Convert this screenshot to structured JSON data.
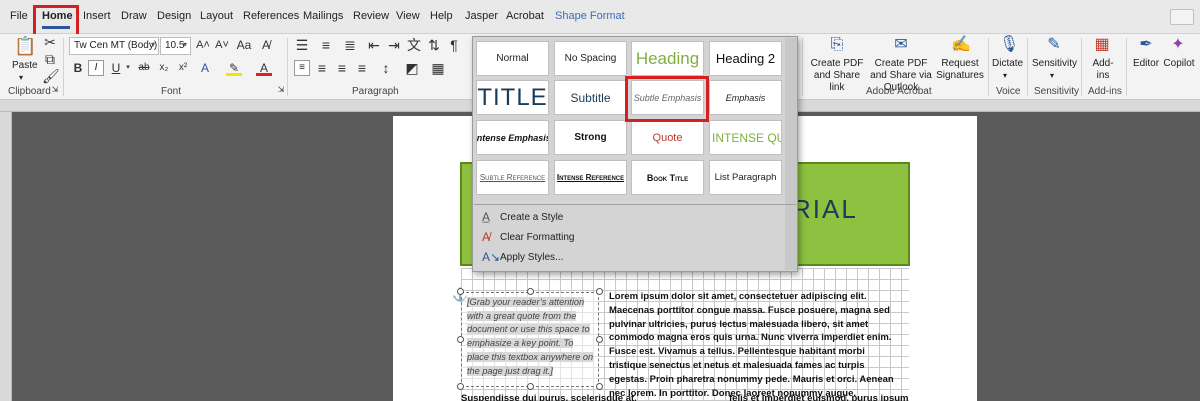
{
  "tabs": [
    {
      "label": "File"
    },
    {
      "label": "Home"
    },
    {
      "label": "Insert"
    },
    {
      "label": "Draw"
    },
    {
      "label": "Design"
    },
    {
      "label": "Layout"
    },
    {
      "label": "References"
    },
    {
      "label": "Mailings"
    },
    {
      "label": "Review"
    },
    {
      "label": "View"
    },
    {
      "label": "Help"
    },
    {
      "label": "Jasper"
    },
    {
      "label": "Acrobat"
    },
    {
      "label": "Shape Format"
    }
  ],
  "ribbon": {
    "clipboard": {
      "paste_label": "Paste",
      "group_label": "Clipboard"
    },
    "font": {
      "font_name": "Tw Cen MT (Body)",
      "font_size": "10.5",
      "group_label": "Font"
    },
    "paragraph": {
      "group_label": "Paragraph"
    },
    "acrobat": {
      "create_pdf_share_link": "Create PDF and Share link",
      "create_pdf_share_outlook": "Create PDF and Share via Outlook",
      "request_signatures": "Request Signatures",
      "group_label": "Adobe Acrobat"
    },
    "voice": {
      "dictate": "Dictate",
      "group_label": "Voice"
    },
    "sensitivity": {
      "button": "Sensitivity",
      "group_label": "Sensitivity"
    },
    "addins": {
      "button": "Add-ins",
      "group_label": "Add-ins"
    },
    "editor": "Editor",
    "copilot": "Copilot"
  },
  "styles_gallery": {
    "styles": [
      "Normal",
      "No Spacing",
      "Heading",
      "Heading 2",
      "TITLE",
      "Subtitle",
      "Subtle Emphasis",
      "Emphasis",
      "Intense Emphasis",
      "Strong",
      "Quote",
      "INTENSE QU",
      "Subtle Reference",
      "Intense Reference",
      "Book Title",
      "List Paragraph"
    ],
    "menu": [
      "Create a Style",
      "Clear Formatting",
      "Apply Styles..."
    ]
  },
  "document": {
    "banner_title": "RIAL",
    "quote": "[Grab your reader’s attention with a great quote from the document or use this space to emphasize a key point. To place this textbox anywhere on the page just drag it.]",
    "body_paragraph": "Lorem ipsum dolor sit amet, consectetuer adipiscing elit. Maecenas porttitor congue massa. Fusce posuere, magna sed pulvinar ultricies, purus lectus malesuada libero, sit amet commodo magna eros quis urna. Nunc viverra imperdiet enim. Fusce est. Vivamus a tellus. Pellentesque habitant morbi tristique senectus et netus et malesuada fames ac turpis egestas. Proin pharetra nonummy pede. Mauris et orci. Aenean nec lorem. In porttitor. Donec laoreet nonummy augue.",
    "body_line2_left": "Suspendisse dui purus, scelerisque at,",
    "body_line2_right": "felis et imperdiet euismod, purus ipsum"
  },
  "colors": {
    "accent_blue": "#2b579a",
    "highlight_red": "#d61f1f",
    "banner_green": "#8ec13f",
    "heading_green": "#7fb03a"
  }
}
